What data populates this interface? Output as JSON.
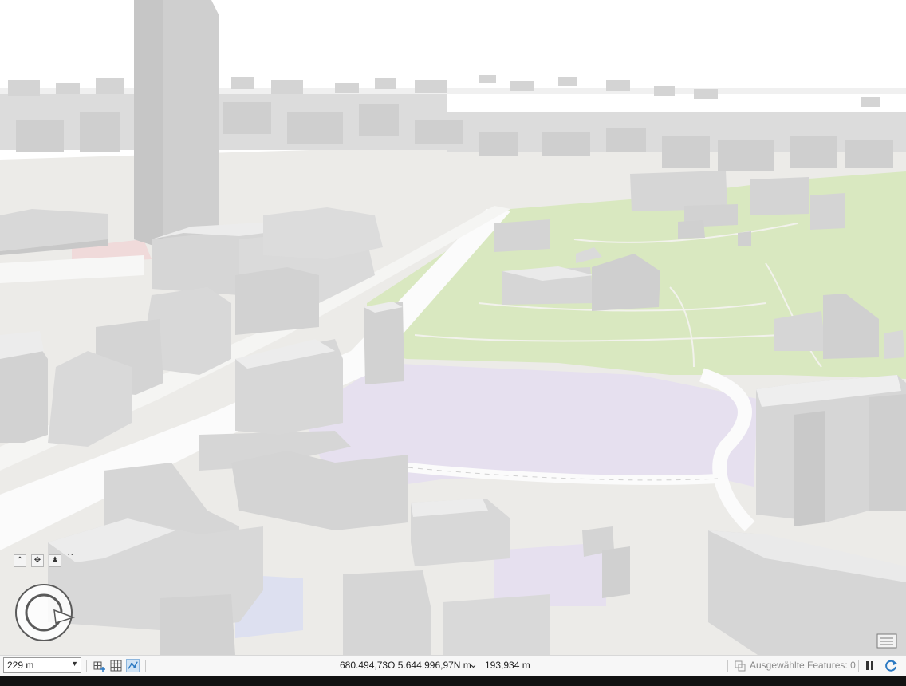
{
  "statusbar": {
    "scale_value": "229 m",
    "coordinates": "680.494,73O 5.644.996,97N m",
    "heading": "193,934 m",
    "selected_features_label": "Ausgewählte Features: 0"
  },
  "map": {
    "colors": {
      "building": "#dadada",
      "park": "#d9e8c0",
      "institutional": "#e6e0ef",
      "road": "#fbfbfb",
      "ground": "#ecebe8"
    }
  },
  "icons": {
    "nav_up": "chevron-up-icon",
    "nav_full_control": "full-control-icon",
    "nav_walk": "walk-icon",
    "compass": "navigator-compass-icon",
    "pause": "pause-icon",
    "refresh": "refresh-icon"
  }
}
